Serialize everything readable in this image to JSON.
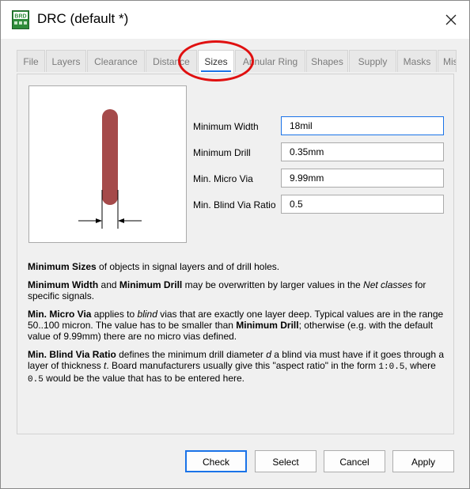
{
  "window": {
    "app_icon_text": "BRD",
    "title": "DRC (default *)",
    "close_icon": "close-icon"
  },
  "tabs": [
    {
      "label": "File"
    },
    {
      "label": "Layers"
    },
    {
      "label": "Clearance"
    },
    {
      "label": "Distance"
    },
    {
      "label": "Sizes",
      "active": true
    },
    {
      "label": "Annular Ring"
    },
    {
      "label": "Shapes"
    },
    {
      "label": "Supply"
    },
    {
      "label": "Masks"
    },
    {
      "label": "Mis"
    }
  ],
  "form": {
    "min_width": {
      "label": "Minimum Width",
      "value": "18mil"
    },
    "min_drill": {
      "label": "Minimum Drill",
      "value": "0.35mm"
    },
    "min_micro_via": {
      "label": "Min. Micro Via",
      "value": "9.99mm"
    },
    "min_blind_via_ratio": {
      "label": "Min. Blind Via Ratio",
      "value": "0.5"
    }
  },
  "description": {
    "p1": {
      "b1": "Minimum Sizes",
      "t1": " of objects in signal layers and of drill holes."
    },
    "p2": {
      "b1": "Minimum Width",
      "t1": " and ",
      "b2": "Minimum Drill",
      "t2": " may be overwritten by larger values in the ",
      "i1": "Net classes",
      "t3": " for specific signals."
    },
    "p3": {
      "b1": "Min. Micro Via",
      "t1": " applies to ",
      "i1": "blind",
      "t2": " vias that are exactly one layer deep. Typical values are in the range 50..100 micron. The value has to be smaller than ",
      "b2": "Minimum Drill",
      "t3": "; otherwise (e.g. with the default value of 9.99mm) there are no micro vias defined."
    },
    "p4": {
      "b1": "Min. Blind Via Ratio",
      "t1": " defines the minimum drill diameter ",
      "i1": "d",
      "t2": " a blind via must have if it goes through a layer of thickness ",
      "i2": "t",
      "t3": ". Board manufacturers usually give this \"aspect ratio\" in the form ",
      "m1": "1:0.5",
      "t4": ", where ",
      "m2": "0.5",
      "t5": " would be the value that has to be entered here."
    }
  },
  "buttons": {
    "check": "Check",
    "select": "Select",
    "cancel": "Cancel",
    "apply": "Apply"
  },
  "colors": {
    "accent": "#1a73e8",
    "annotation": "#e01010",
    "trace": "#a54a4a"
  }
}
